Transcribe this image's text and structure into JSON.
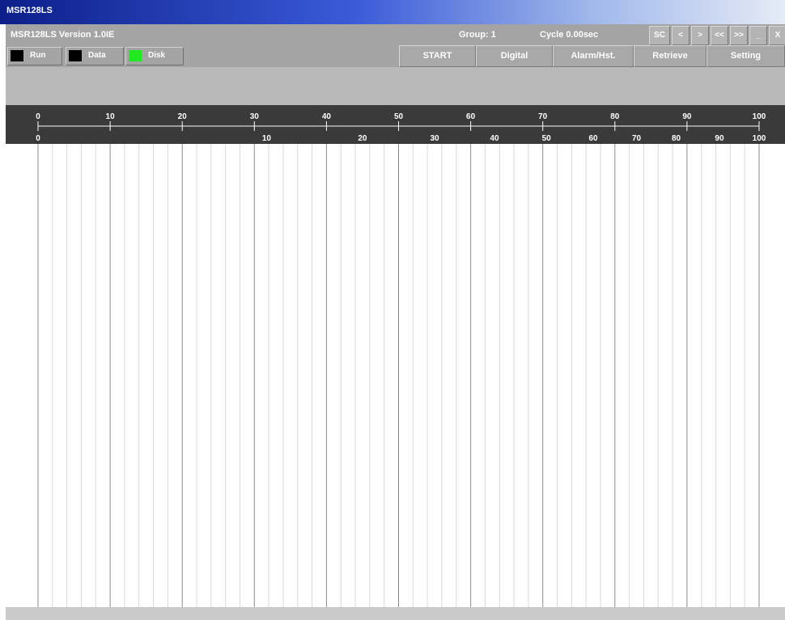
{
  "window": {
    "title": "MSR128LS"
  },
  "header": {
    "version": "MSR128LS Version 1.0IE",
    "group": "Group: 1",
    "cycle": "Cycle 0.00sec"
  },
  "system_buttons": [
    "SC",
    "<",
    ">",
    "<<",
    ">>",
    "_",
    "X"
  ],
  "indicators": [
    {
      "label": "Run",
      "color": "#000000"
    },
    {
      "label": "Data",
      "color": "#000000"
    },
    {
      "label": "Disk",
      "color": "#22e822"
    }
  ],
  "nav": [
    "START",
    "Digital",
    "Alarm/Hst.",
    "Retrieve",
    "Setting"
  ],
  "scale_top": [
    "0",
    "10",
    "20",
    "30",
    "40",
    "50",
    "60",
    "70",
    "80",
    "90",
    "100"
  ],
  "scale_bottom": [
    "0",
    "10",
    "20",
    "30",
    "40",
    "50",
    "60",
    "70",
    "80",
    "90",
    "100"
  ],
  "colors": {
    "title_bar": "#0c1f8a",
    "panel": "#a4a4a4",
    "scale_bg": "#3a3a3a",
    "disk_on": "#22e822"
  }
}
